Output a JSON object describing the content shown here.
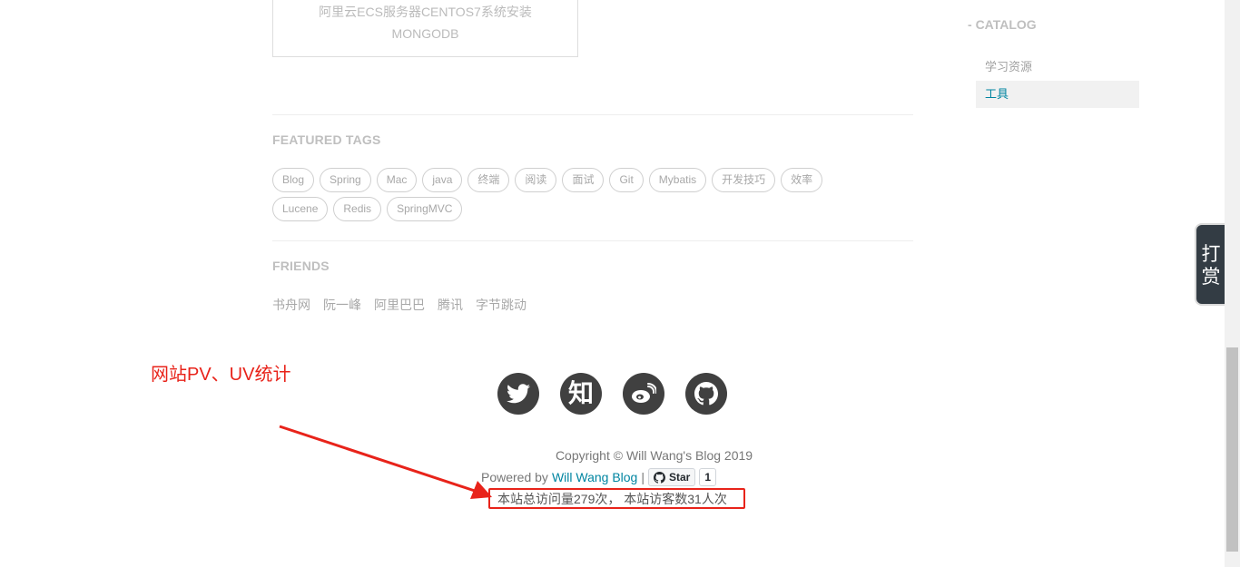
{
  "prev_post": {
    "line1": "阿里云ECS服务器CENTOS7系统安装",
    "line2": "MONGODB"
  },
  "featured_tags": {
    "title": "FEATURED TAGS",
    "tags": [
      "Blog",
      "Spring",
      "Mac",
      "java",
      "终端",
      "阅读",
      "面试",
      "Git",
      "Mybatis",
      "开发技巧",
      "效率",
      "Lucene",
      "Redis",
      "SpringMVC"
    ]
  },
  "friends": {
    "title": "FRIENDS",
    "links": [
      "书舟网",
      "阮一峰",
      "阿里巴巴",
      "腾讯",
      "字节跳动"
    ]
  },
  "catalog": {
    "title": "CATALOG",
    "items": [
      {
        "label": "学习资源"
      },
      {
        "label": "工具"
      }
    ]
  },
  "reward": {
    "char1": "打",
    "char2": "赏"
  },
  "annotation": {
    "label": "网站PV、UV统计",
    "color": "#e8231a"
  },
  "social_icons": [
    "twitter-icon",
    "zhihu-icon",
    "weibo-icon",
    "github-icon"
  ],
  "zhihu_glyph": "知",
  "footer": {
    "copyright": "Copyright © Will Wang's Blog 2019",
    "powered_prefix": "Powered by",
    "powered_link": "Will Wang Blog",
    "separator": "|",
    "star_label": "Star",
    "star_count": "1",
    "stats": "本站总访问量279次， 本站访客数31人次"
  },
  "colors": {
    "accent": "#0085a1",
    "annotation": "#e8231a",
    "social_bg": "#404040"
  }
}
